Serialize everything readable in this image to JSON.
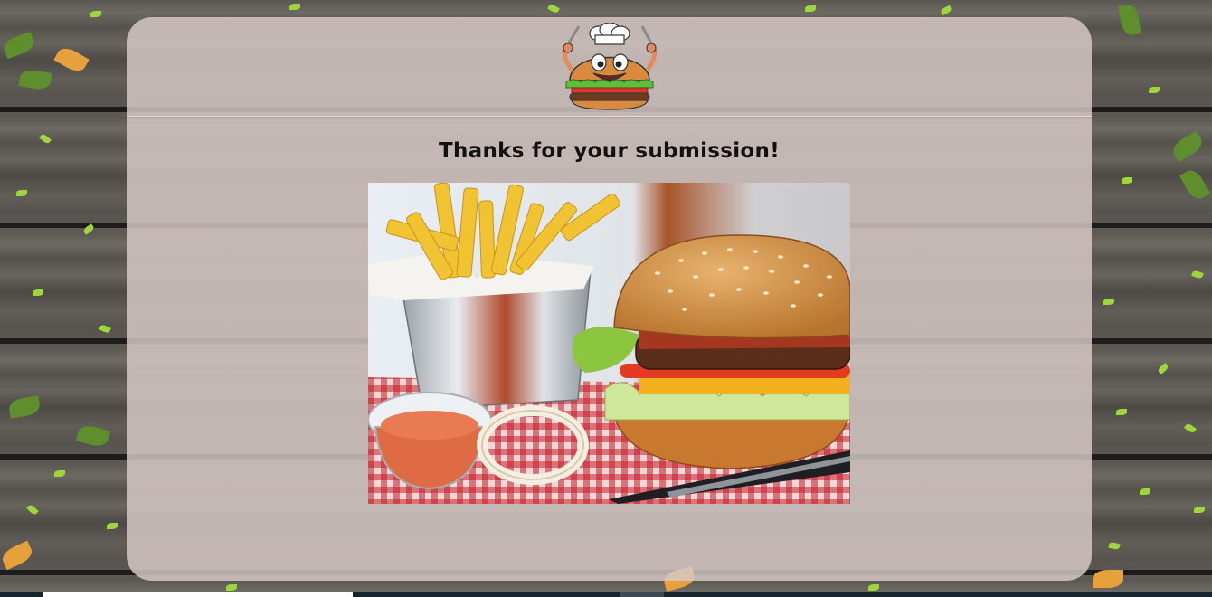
{
  "page": {
    "heading": "Thanks for your submission!"
  },
  "logo": {
    "icon": "burger-chef-mascot-icon"
  },
  "photo": {
    "subject": "burger-and-fries-photo"
  },
  "colors": {
    "card_background": "#d6c8c6",
    "heading_text": "#111111",
    "wood_background": "#5a5752",
    "leaf_accent": "#9fd63a"
  }
}
